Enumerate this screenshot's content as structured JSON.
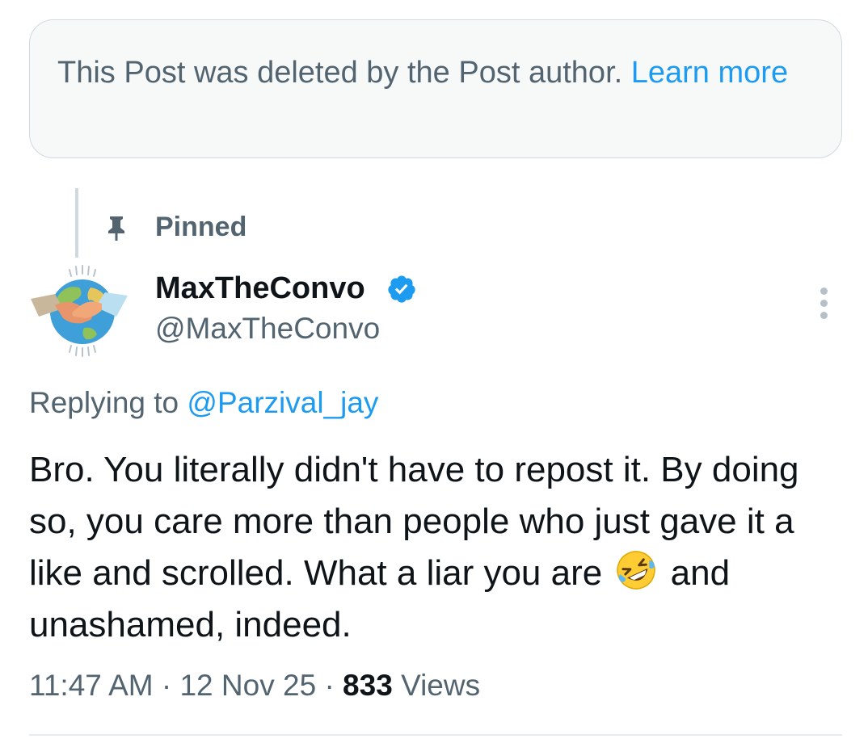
{
  "deleted_notice": {
    "text": "This Post was deleted by the Post author. ",
    "link": "Learn more"
  },
  "pinned": {
    "label": "Pinned"
  },
  "author": {
    "display_name": "MaxTheConvo",
    "handle": "@MaxTheConvo",
    "verified": true,
    "avatar_icon": "handshake-globe-avatar"
  },
  "reply": {
    "prefix": "Replying to ",
    "mention": "@Parzival_jay"
  },
  "tweet": {
    "text_before_emoji": "Bro. You literally didn't have to repost it. By doing so, you care more than people who just gave it a like and scrolled. What a liar you are",
    "emoji": "rolling-on-the-floor-laughing",
    "text_after_emoji": "and unashamed, indeed."
  },
  "meta": {
    "time": "11:47 AM",
    "separator": "·",
    "date": "12 Nov 25",
    "views_count": "833",
    "views_label": "Views"
  },
  "colors": {
    "link": "#1d9bf0",
    "secondary_text": "#536471",
    "primary_text": "#0f1419"
  }
}
